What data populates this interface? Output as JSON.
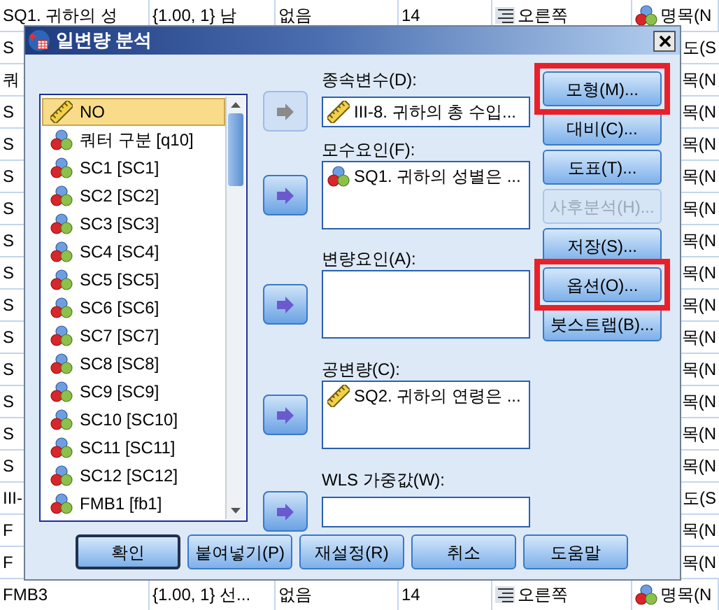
{
  "data_grid": {
    "rows": [
      {
        "kind": "full",
        "cells": [
          "SQ1. 귀하의 성",
          "{1.00, 1} 남",
          "없음",
          "14",
          "오른쪽",
          "명목(N"
        ]
      },
      {
        "kind": "covered",
        "left": "S",
        "right": "도(S"
      },
      {
        "kind": "covered",
        "left": "쿼",
        "right": "목(N"
      },
      {
        "kind": "covered",
        "left": "S",
        "right": "목(N"
      },
      {
        "kind": "covered",
        "left": "S",
        "right": "목(N"
      },
      {
        "kind": "covered",
        "left": "S",
        "right": "목(N"
      },
      {
        "kind": "covered",
        "left": "S",
        "right": "목(N"
      },
      {
        "kind": "covered",
        "left": "S",
        "right": "목(N"
      },
      {
        "kind": "covered",
        "left": "S",
        "right": "목(N"
      },
      {
        "kind": "covered",
        "left": "S",
        "right": "목(N"
      },
      {
        "kind": "covered",
        "left": "S",
        "right": "목(N"
      },
      {
        "kind": "covered",
        "left": "S",
        "right": "목(N"
      },
      {
        "kind": "covered",
        "left": "S",
        "right": "목(N"
      },
      {
        "kind": "covered",
        "left": "S",
        "right": "목(N"
      },
      {
        "kind": "covered",
        "left": "S",
        "right": "목(N"
      },
      {
        "kind": "covered",
        "left": "III-",
        "right": "도(S"
      },
      {
        "kind": "covered",
        "left": "F",
        "right": "목(N"
      },
      {
        "kind": "covered",
        "left": "F",
        "right": "목(N"
      },
      {
        "kind": "full",
        "cells": [
          "FMB3",
          "{1.00, 1} 선...",
          "없음",
          "14",
          "오른쪽",
          "명목(N"
        ]
      }
    ]
  },
  "dialog": {
    "title": "일변량 분석",
    "variables": [
      {
        "label": "NO",
        "kind": "scale",
        "selected": true
      },
      {
        "label": "쿼터 구분 [q10]",
        "kind": "nominal",
        "selected": false
      },
      {
        "label": "SC1 [SC1]",
        "kind": "nominal",
        "selected": false
      },
      {
        "label": "SC2 [SC2]",
        "kind": "nominal",
        "selected": false
      },
      {
        "label": "SC3 [SC3]",
        "kind": "nominal",
        "selected": false
      },
      {
        "label": "SC4 [SC4]",
        "kind": "nominal",
        "selected": false
      },
      {
        "label": "SC5 [SC5]",
        "kind": "nominal",
        "selected": false
      },
      {
        "label": "SC6 [SC6]",
        "kind": "nominal",
        "selected": false
      },
      {
        "label": "SC7 [SC7]",
        "kind": "nominal",
        "selected": false
      },
      {
        "label": "SC8 [SC8]",
        "kind": "nominal",
        "selected": false
      },
      {
        "label": "SC9 [SC9]",
        "kind": "nominal",
        "selected": false
      },
      {
        "label": "SC10 [SC10]",
        "kind": "nominal",
        "selected": false
      },
      {
        "label": "SC11 [SC11]",
        "kind": "nominal",
        "selected": false
      },
      {
        "label": "SC12 [SC12]",
        "kind": "nominal",
        "selected": false
      },
      {
        "label": "FMB1 [fb1]",
        "kind": "nominal",
        "selected": false
      }
    ],
    "targets": [
      {
        "label": "종속변수(D):",
        "kind": "single",
        "arrow_disabled": true,
        "items": [
          {
            "label": "III-8. 귀하의 총 수입...",
            "kind": "scale"
          }
        ]
      },
      {
        "label": "모수요인(F):",
        "kind": "list",
        "arrow_disabled": false,
        "items": [
          {
            "label": "SQ1. 귀하의 성별은 ...",
            "kind": "nominal"
          }
        ]
      },
      {
        "label": "변량요인(A):",
        "kind": "list",
        "arrow_disabled": false
      },
      {
        "label": "공변량(C):",
        "kind": "list",
        "arrow_disabled": false,
        "items": [
          {
            "label": "SQ2. 귀하의 연령은 ...",
            "kind": "scale"
          }
        ]
      },
      {
        "label": "WLS 가중값(W):",
        "kind": "single",
        "arrow_disabled": false
      }
    ],
    "side_buttons": [
      {
        "label": "모형(M)...",
        "disabled": false,
        "highlighted": true
      },
      {
        "label": "대비(C)...",
        "disabled": false,
        "highlighted": false
      },
      {
        "label": "도표(T)...",
        "disabled": false,
        "highlighted": false
      },
      {
        "label": "사후분석(H)...",
        "disabled": true,
        "highlighted": false
      },
      {
        "label": "저장(S)...",
        "disabled": false,
        "highlighted": false
      },
      {
        "label": "옵션(O)...",
        "disabled": false,
        "highlighted": true
      },
      {
        "label": "붓스트랩(B)...",
        "disabled": false,
        "highlighted": false
      }
    ],
    "bottom_buttons": [
      {
        "label": "확인",
        "default": true
      },
      {
        "label": "붙여넣기(P)",
        "default": false
      },
      {
        "label": "재설정(R)",
        "default": false
      },
      {
        "label": "취소",
        "default": false
      },
      {
        "label": "도움말",
        "default": false
      }
    ]
  }
}
